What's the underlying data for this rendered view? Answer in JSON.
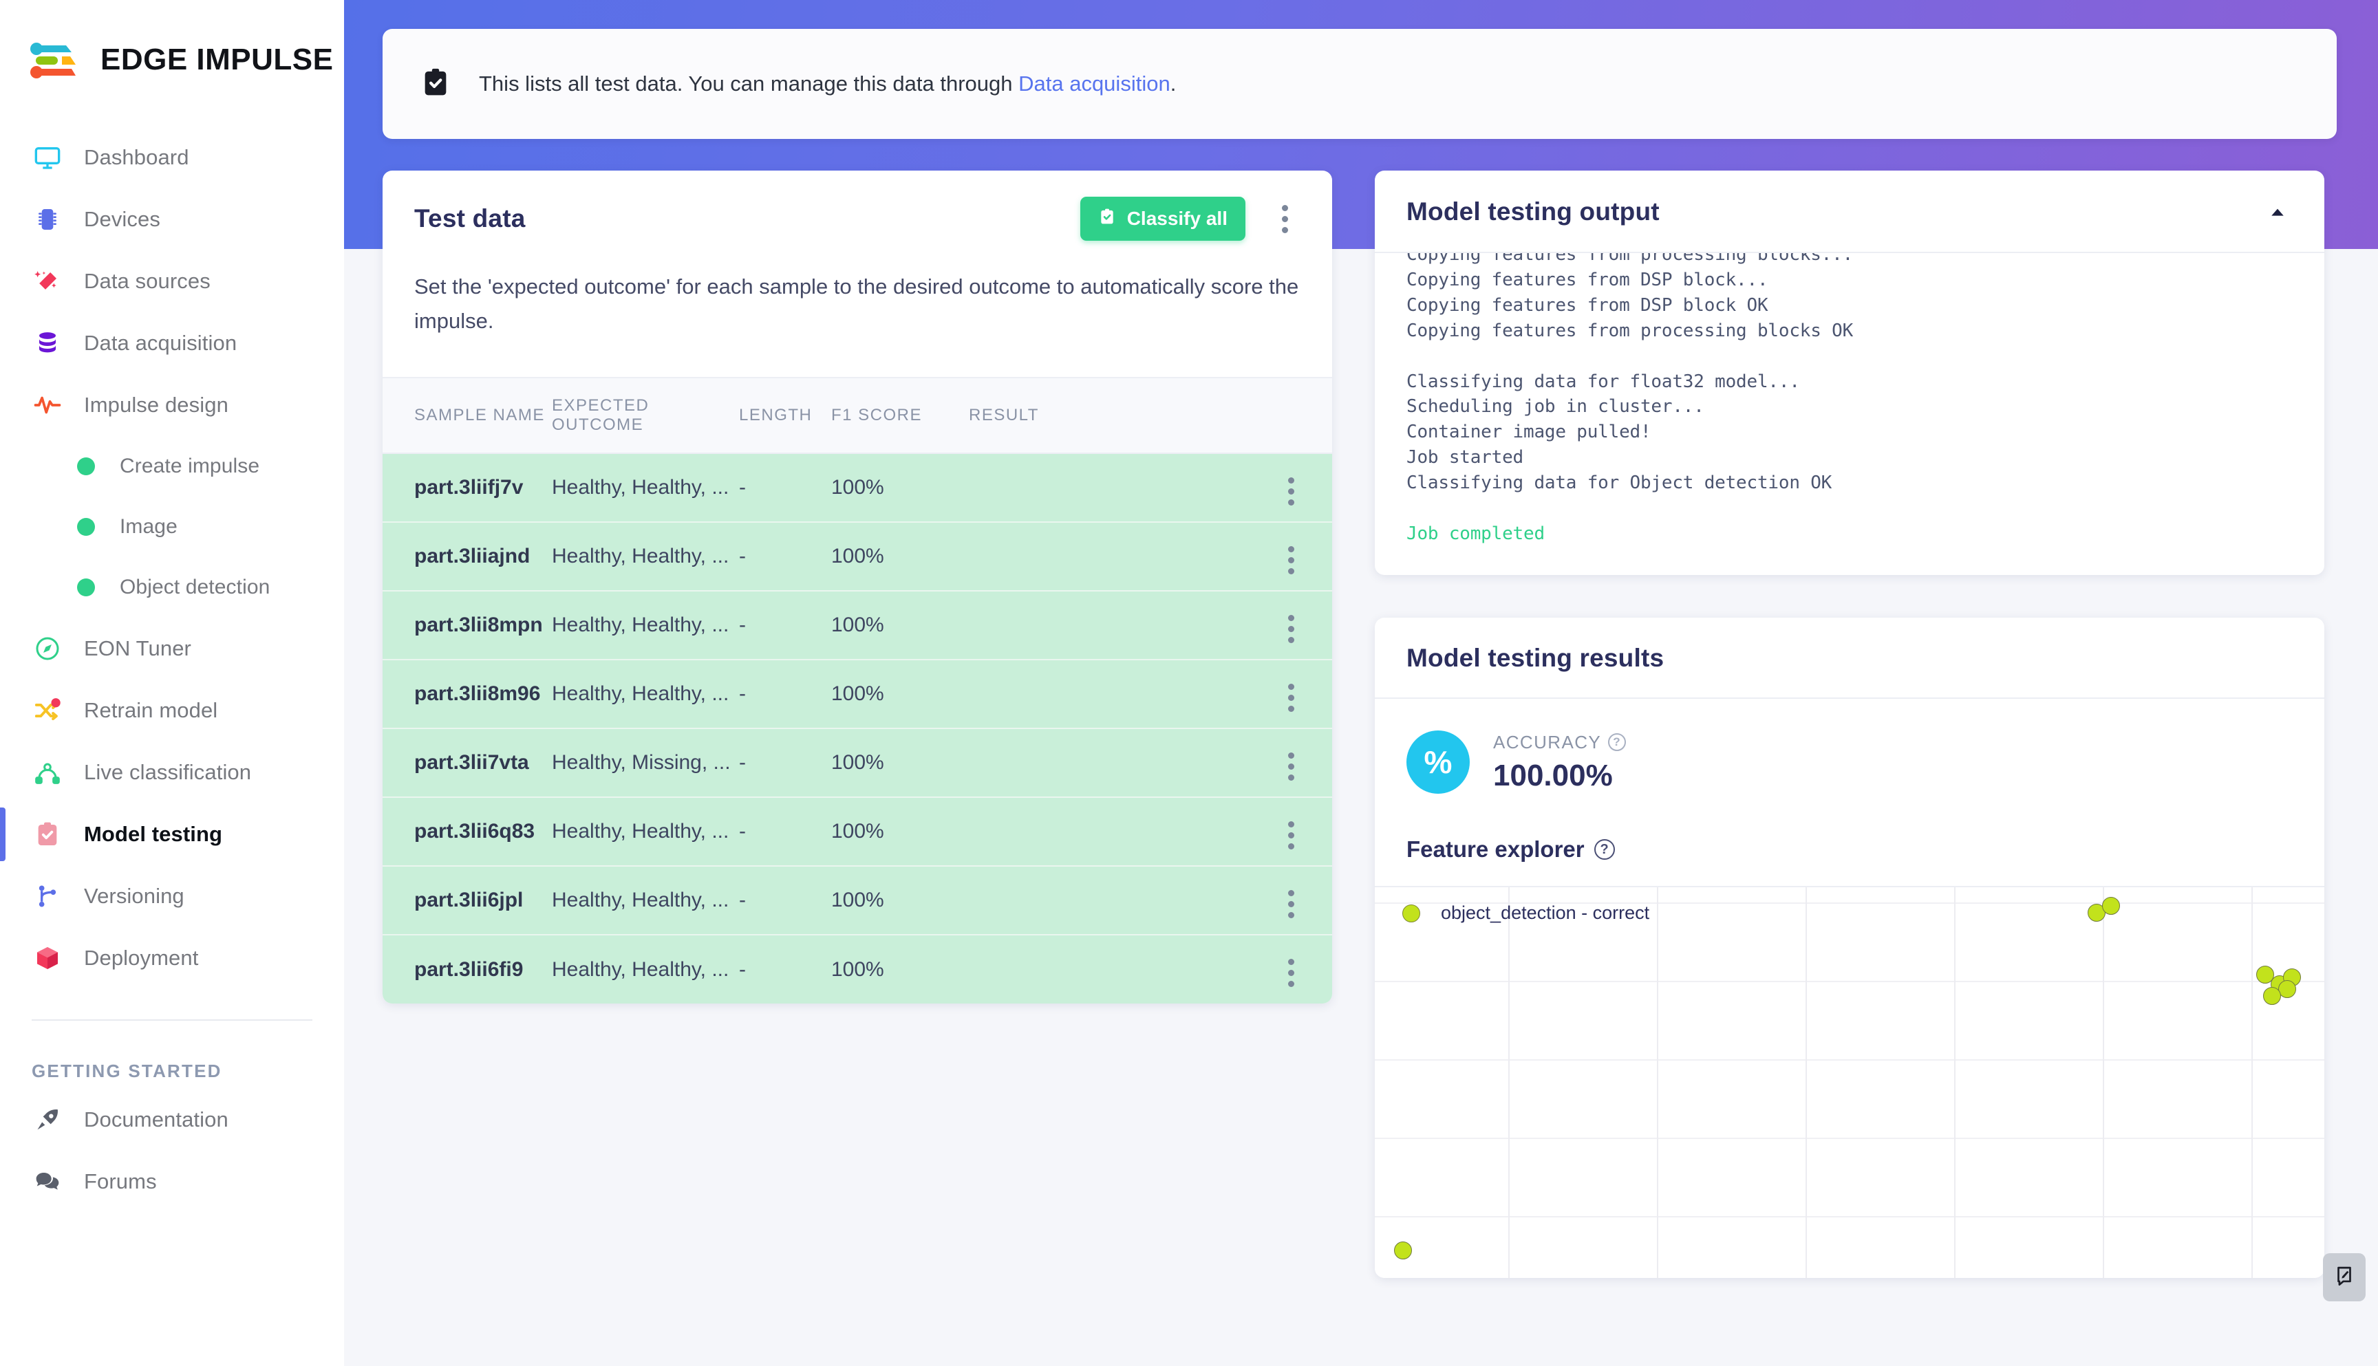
{
  "brand": {
    "name": "EDGE IMPULSE"
  },
  "sidebar": {
    "items": [
      {
        "label": "Dashboard",
        "icon": "monitor-icon"
      },
      {
        "label": "Devices",
        "icon": "chip-icon"
      },
      {
        "label": "Data sources",
        "icon": "magic-wand-icon"
      },
      {
        "label": "Data acquisition",
        "icon": "database-icon"
      },
      {
        "label": "Impulse design",
        "icon": "pulse-icon"
      }
    ],
    "sub_items": [
      {
        "label": "Create impulse"
      },
      {
        "label": "Image"
      },
      {
        "label": "Object detection"
      }
    ],
    "items2": [
      {
        "label": "EON Tuner",
        "icon": "compass-icon"
      },
      {
        "label": "Retrain model",
        "icon": "shuffle-icon"
      },
      {
        "label": "Live classification",
        "icon": "graph-nodes-icon"
      },
      {
        "label": "Model testing",
        "icon": "clipboard-check-icon",
        "active": true
      },
      {
        "label": "Versioning",
        "icon": "git-branch-icon"
      },
      {
        "label": "Deployment",
        "icon": "cube-icon"
      }
    ],
    "section_title": "GETTING STARTED",
    "footer_items": [
      {
        "label": "Documentation",
        "icon": "rocket-icon"
      },
      {
        "label": "Forums",
        "icon": "chat-bubbles-icon"
      }
    ]
  },
  "banner": {
    "icon": "clipboard-check-icon",
    "text_before": "This lists all test data. You can manage this data through ",
    "link": "Data acquisition",
    "text_after": "."
  },
  "test_data": {
    "title": "Test data",
    "classify_all_label": "Classify all",
    "help": "Set the 'expected outcome' for each sample to the desired outcome to automatically score the impulse.",
    "columns": [
      "SAMPLE NAME",
      "EXPECTED OUTCOME",
      "LENGTH",
      "F1 SCORE",
      "RESULT"
    ],
    "rows": [
      {
        "name": "part.3liifj7v",
        "expected": "Healthy, Healthy, ...",
        "length": "-",
        "f1": "100%",
        "result": ""
      },
      {
        "name": "part.3liiajnd",
        "expected": "Healthy, Healthy, ...",
        "length": "-",
        "f1": "100%",
        "result": ""
      },
      {
        "name": "part.3lii8mpn",
        "expected": "Healthy, Healthy, ...",
        "length": "-",
        "f1": "100%",
        "result": ""
      },
      {
        "name": "part.3lii8m96",
        "expected": "Healthy, Healthy, ...",
        "length": "-",
        "f1": "100%",
        "result": ""
      },
      {
        "name": "part.3lii7vta",
        "expected": "Healthy, Missing, ...",
        "length": "-",
        "f1": "100%",
        "result": ""
      },
      {
        "name": "part.3lii6q83",
        "expected": "Healthy, Healthy, ...",
        "length": "-",
        "f1": "100%",
        "result": ""
      },
      {
        "name": "part.3lii6jpl",
        "expected": "Healthy, Healthy, ...",
        "length": "-",
        "f1": "100%",
        "result": ""
      },
      {
        "name": "part.3lii6fi9",
        "expected": "Healthy, Healthy, ...",
        "length": "-",
        "f1": "100%",
        "result": ""
      }
    ]
  },
  "output_panel": {
    "title": "Model testing output",
    "log": "Copying features from processing blocks...\nCopying features from DSP block...\nCopying features from DSP block OK\nCopying features from processing blocks OK\n\nClassifying data for float32 model...\nScheduling job in cluster...\nContainer image pulled!\nJob started\nClassifying data for Object detection OK\n\n",
    "log_done": "Job completed"
  },
  "results_panel": {
    "title": "Model testing results",
    "accuracy_label": "ACCURACY",
    "accuracy_value": "100.00%",
    "badge_glyph": "%",
    "feature_explorer_title": "Feature explorer"
  },
  "chart_data": {
    "type": "scatter",
    "title": "Feature explorer",
    "legend": [
      {
        "name": "object_detection - correct",
        "color": "#c2e21c"
      }
    ],
    "legend_position": "top-left",
    "grid": true,
    "xlabel": "",
    "ylabel": "",
    "series": [
      {
        "name": "object_detection - correct",
        "color": "#c2e21c",
        "points": [
          {
            "x": 0.76,
            "y": 0.934
          },
          {
            "x": 0.775,
            "y": 0.952
          },
          {
            "x": 0.938,
            "y": 0.777
          },
          {
            "x": 0.953,
            "y": 0.752
          },
          {
            "x": 0.966,
            "y": 0.77
          },
          {
            "x": 0.961,
            "y": 0.74
          },
          {
            "x": 0.945,
            "y": 0.722
          },
          {
            "x": 0.03,
            "y": 0.07
          }
        ]
      }
    ]
  },
  "chat_widget": {
    "icon": "chat-edit-icon"
  },
  "colors": {
    "brand_blue": "#5570e8",
    "brand_purple": "#8b5fd6",
    "accent_green": "#2fd08a",
    "row_green": "#c9efd9",
    "accent_cyan": "#22c6ee",
    "link_blue": "#5874ee",
    "point_green": "#c2e21c"
  }
}
